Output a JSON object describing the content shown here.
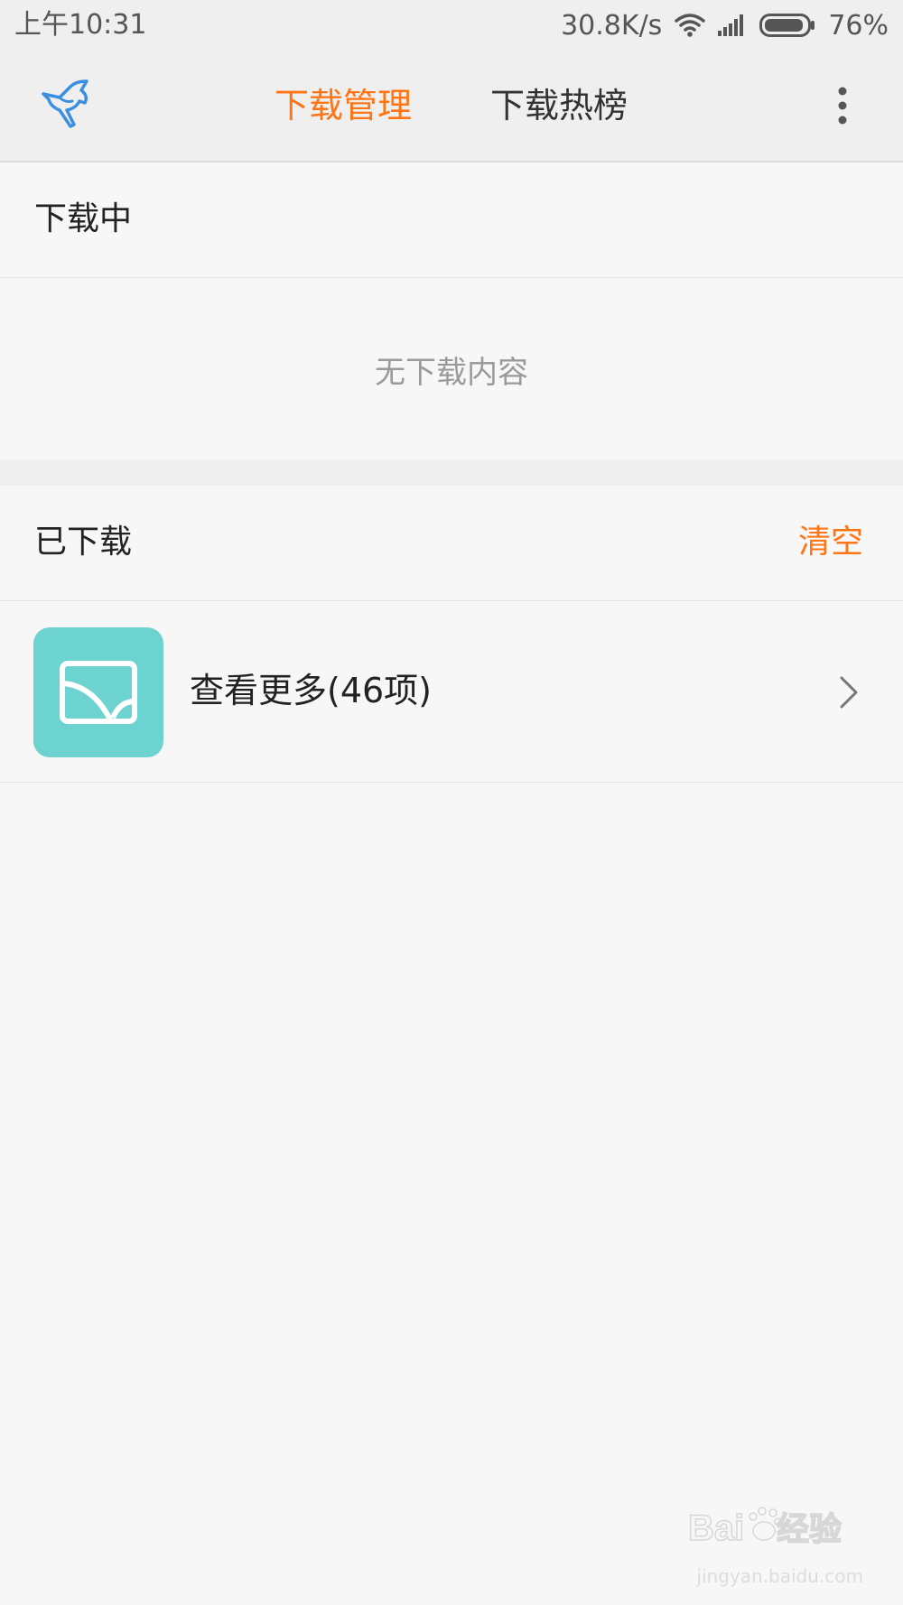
{
  "status_bar": {
    "time": "上午10:31",
    "net_speed": "30.8K/s",
    "battery": "76%"
  },
  "header": {
    "tabs": [
      {
        "label": "下载管理",
        "active": true
      },
      {
        "label": "下载热榜",
        "active": false
      }
    ],
    "accent_color": "#ff7516",
    "logo_icon": "bird-logo-icon",
    "more_icon": "more-vertical-icon"
  },
  "downloading": {
    "title": "下载中",
    "empty_text": "无下载内容"
  },
  "downloaded": {
    "title": "已下载",
    "clear_label": "清空",
    "item": {
      "label": "查看更多(46项)",
      "icon": "image-gallery-icon",
      "icon_color": "#6dd3d1"
    }
  },
  "watermark": {
    "text": "Baidu经验",
    "url": "jingyan.baidu.com"
  }
}
